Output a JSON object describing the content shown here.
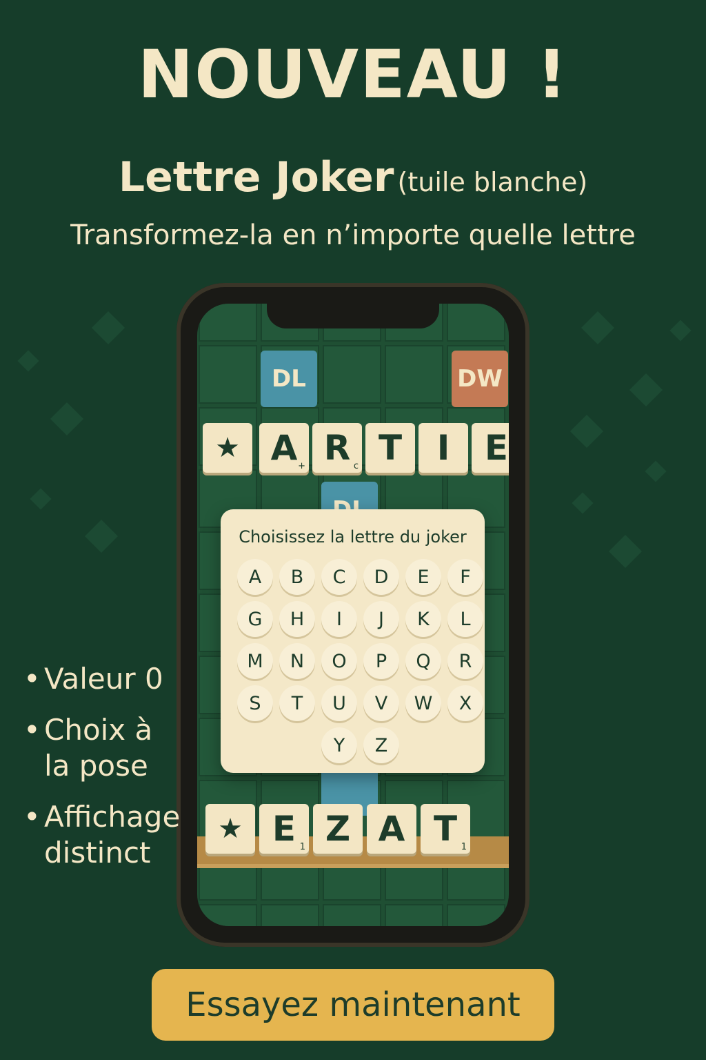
{
  "headline": "NOUVEAU !",
  "subhead": {
    "title": "Lettre Joker",
    "note": "(tuile blanche)"
  },
  "tagline": "Transformez-la en n’importe quelle lettre",
  "board": {
    "premium": {
      "dl": "DL",
      "dw": "DW"
    },
    "word_row": [
      {
        "letter": "★",
        "score": ""
      },
      {
        "letter": "A",
        "score": "+"
      },
      {
        "letter": "R",
        "score": "c"
      },
      {
        "letter": "T",
        "score": ""
      },
      {
        "letter": "I",
        "score": ""
      },
      {
        "letter": "E",
        "score": "+"
      }
    ],
    "rack": [
      {
        "letter": "★",
        "score": ""
      },
      {
        "letter": "E",
        "score": "1"
      },
      {
        "letter": "Z",
        "score": ""
      },
      {
        "letter": "A",
        "score": ""
      },
      {
        "letter": "T",
        "score": "1"
      }
    ]
  },
  "dialog": {
    "title": "Choisissez la lettre du joker",
    "letters": [
      "A",
      "B",
      "C",
      "D",
      "E",
      "F",
      "G",
      "H",
      "I",
      "J",
      "K",
      "L",
      "M",
      "N",
      "O",
      "P",
      "Q",
      "R",
      "S",
      "T",
      "U",
      "V",
      "W",
      "X",
      "Y",
      "Z"
    ]
  },
  "bullets": [
    "Valeur 0",
    "Choix à la pose",
    "Affichage distinct"
  ],
  "cta": "Essayez maintenant",
  "colors": {
    "background": "#163d2a",
    "cream": "#f4e7c5",
    "dl": "#4a93a6",
    "dw": "#c47a55",
    "cta": "#e5b54f"
  }
}
